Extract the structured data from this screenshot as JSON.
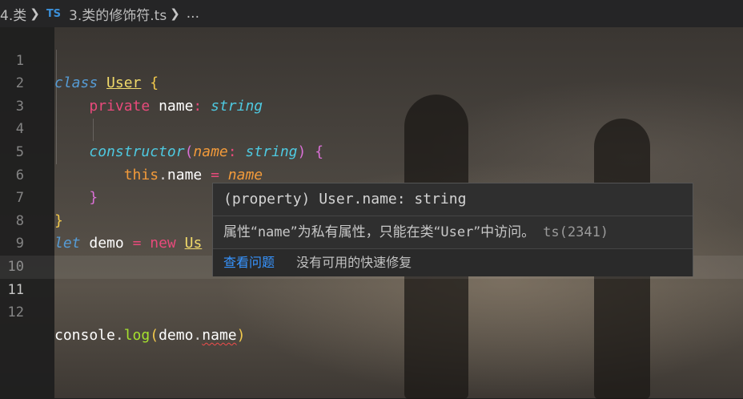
{
  "breadcrumb": {
    "folder": "4.类",
    "file_icon": "TS",
    "file": "3.类的修饰符.ts",
    "more": "..."
  },
  "editor": {
    "current_line": 11,
    "lines": [
      {
        "number": "1"
      },
      {
        "number": "2"
      },
      {
        "number": "3"
      },
      {
        "number": "4"
      },
      {
        "number": "5"
      },
      {
        "number": "6"
      },
      {
        "number": "7"
      },
      {
        "number": "8"
      },
      {
        "number": "9"
      },
      {
        "number": "10"
      },
      {
        "number": "11"
      },
      {
        "number": "12"
      }
    ],
    "tokens": {
      "l1_class": "class",
      "l1_name": "User",
      "l1_brace": "{",
      "l2_private": "private",
      "l2_prop": "name",
      "l2_colon": ":",
      "l2_type": "string",
      "l4_ctor": "constructor",
      "l4_lparen": "(",
      "l4_param": "name",
      "l4_colon": ":",
      "l4_type": "string",
      "l4_rparen": ")",
      "l4_brace": "{",
      "l5_this": "this",
      "l5_dot": ".",
      "l5_prop": "name",
      "l5_eq": "=",
      "l5_param": "name",
      "l6_brace": "}",
      "l7_brace": "}",
      "l8_let": "let",
      "l8_var": "demo",
      "l8_eq": "=",
      "l8_new": "new",
      "l8_cls": "Us",
      "l12_console": "console",
      "l12_dot": ".",
      "l12_log": "log",
      "l12_lparen": "(",
      "l12_demo": "demo",
      "l12_dot2": ".",
      "l12_name": "name",
      "l12_rparen": ")"
    }
  },
  "hover": {
    "signature": "(property) User.name: string",
    "message_pre": "属性“",
    "message_name": "name",
    "message_mid": "”为私有属性，只能在类“",
    "message_class": "User",
    "message_post": "”中访问。",
    "error_code": "ts(2341)",
    "view_problem": "查看问题",
    "no_quick_fix": "没有可用的快速修复"
  },
  "colors": {
    "keyword": "#569cd6",
    "class_name": "#f0d96a",
    "private_keyword": "#e84a7b",
    "type": "#4ec9e0",
    "parameter": "#f29a3a",
    "method": "#a6e22e",
    "error_squiggle": "#f14c4c",
    "link": "#3794ff"
  }
}
